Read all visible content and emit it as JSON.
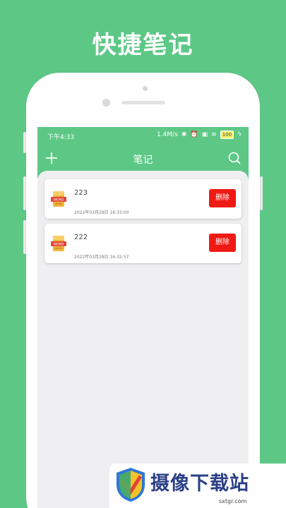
{
  "headline": "快捷笔记",
  "status_bar": {
    "time": "下午4:33",
    "speed": "1.4M/s",
    "battery": "100"
  },
  "titlebar": {
    "title": "笔记",
    "add_icon": "plus-icon",
    "search_icon": "search-icon"
  },
  "notes": [
    {
      "name": "223",
      "date": "2022年03月28日 16:33:00",
      "delete_label": "删除",
      "icon": "word-document-icon"
    },
    {
      "name": "222",
      "date": "2022年03月28日 16:32:57",
      "delete_label": "删除",
      "icon": "word-document-icon"
    }
  ],
  "watermark": {
    "brand": "摄像下载站",
    "url": "sxtgr.com"
  },
  "colors": {
    "brand_green": "#5dc886",
    "delete_red": "#ee1a13",
    "content_bg": "#efeff1",
    "watermark_blue": "#2b3f86"
  }
}
